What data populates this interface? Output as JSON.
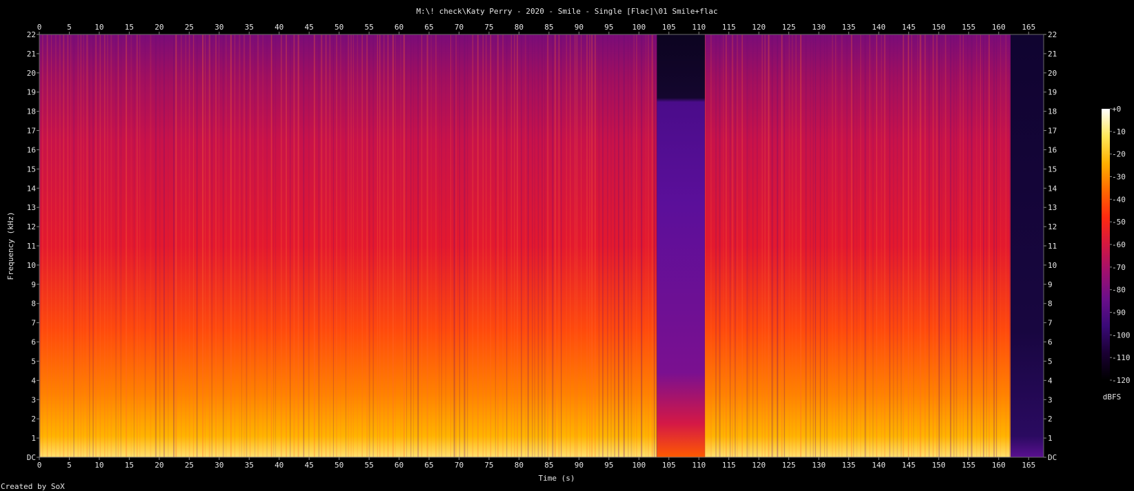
{
  "chart_data": {
    "type": "heatmap",
    "title": "M:\\! check\\Katy Perry - 2020 - Smile - Single [Flac]\\01 Smile+flac",
    "xlabel": "Time (s)",
    "ylabel": "Frequency (kHz)",
    "footer": "Created by SoX",
    "x_range": [
      0,
      167.5
    ],
    "y_range": [
      0,
      22
    ],
    "x_ticks": [
      0,
      5,
      10,
      15,
      20,
      25,
      30,
      35,
      40,
      45,
      50,
      55,
      60,
      65,
      70,
      75,
      80,
      85,
      90,
      95,
      100,
      105,
      110,
      115,
      120,
      125,
      130,
      135,
      140,
      145,
      150,
      155,
      160,
      165
    ],
    "y_ticks": [
      {
        "value": 0,
        "label": "DC"
      },
      {
        "value": 1,
        "label": "1"
      },
      {
        "value": 2,
        "label": "2"
      },
      {
        "value": 3,
        "label": "3"
      },
      {
        "value": 4,
        "label": "4"
      },
      {
        "value": 5,
        "label": "5"
      },
      {
        "value": 6,
        "label": "6"
      },
      {
        "value": 7,
        "label": "7"
      },
      {
        "value": 8,
        "label": "8"
      },
      {
        "value": 9,
        "label": "9"
      },
      {
        "value": 10,
        "label": "10"
      },
      {
        "value": 11,
        "label": "11"
      },
      {
        "value": 12,
        "label": "12"
      },
      {
        "value": 13,
        "label": "13"
      },
      {
        "value": 14,
        "label": "14"
      },
      {
        "value": 15,
        "label": "15"
      },
      {
        "value": 16,
        "label": "16"
      },
      {
        "value": 17,
        "label": "17"
      },
      {
        "value": 18,
        "label": "18"
      },
      {
        "value": 19,
        "label": "19"
      },
      {
        "value": 20,
        "label": "20"
      },
      {
        "value": 21,
        "label": "21"
      },
      {
        "value": 22,
        "label": "22"
      }
    ],
    "colorbar": {
      "label": "dBFS",
      "range": [
        -120,
        0
      ],
      "ticks": [
        {
          "value": 0,
          "label": "+0"
        },
        {
          "value": -10,
          "label": "-10"
        },
        {
          "value": -20,
          "label": "-20"
        },
        {
          "value": -30,
          "label": "-30"
        },
        {
          "value": -40,
          "label": "-40"
        },
        {
          "value": -50,
          "label": "-50"
        },
        {
          "value": -60,
          "label": "-60"
        },
        {
          "value": -70,
          "label": "-70"
        },
        {
          "value": -80,
          "label": "-80"
        },
        {
          "value": -90,
          "label": "-90"
        },
        {
          "value": -100,
          "label": "-100"
        },
        {
          "value": -110,
          "label": "-110"
        },
        {
          "value": -120,
          "label": "-120"
        }
      ],
      "colors": [
        "#000000",
        "#1a0033",
        "#3a0a78",
        "#6b0f8a",
        "#a0106e",
        "#d41840",
        "#ff2a10",
        "#ff6a00",
        "#ffb000",
        "#ffe85a",
        "#ffffff"
      ]
    },
    "segments": [
      {
        "x": [
          0,
          103
        ],
        "level_db": -60
      },
      {
        "x": [
          103,
          111
        ],
        "level_db": -90
      },
      {
        "x": [
          111,
          162
        ],
        "level_db": -60
      },
      {
        "x": [
          162,
          167.5
        ],
        "level_db": -105
      }
    ],
    "cutoff_khz": 22
  }
}
